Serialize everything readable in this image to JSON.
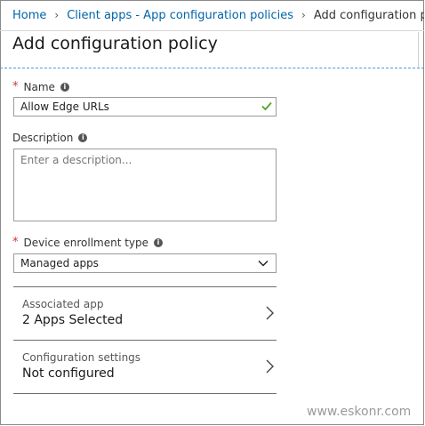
{
  "breadcrumb": {
    "items": [
      "Home",
      "Client apps - App configuration policies",
      "Add configuration policy"
    ]
  },
  "page": {
    "title": "Add configuration policy"
  },
  "form": {
    "name": {
      "label": "Name",
      "value": "Allow Edge URLs",
      "required": "*"
    },
    "description": {
      "label": "Description",
      "placeholder": "Enter a description..."
    },
    "device_enrollment": {
      "label": "Device enrollment type",
      "selected": "Managed apps",
      "required": "*"
    },
    "associated_app": {
      "label": "Associated app",
      "value": "2 Apps Selected"
    },
    "configuration_settings": {
      "label": "Configuration settings",
      "value": "Not configured"
    }
  },
  "watermark": "www.eskonr.com",
  "colors": {
    "link": "#0064a8",
    "accent_dashed": "#41a1d7",
    "check_green": "#5aa02c",
    "required_star": "#c33333"
  },
  "icons": [
    "chevron-right-icon",
    "info-icon",
    "checkmark-icon",
    "chevron-down-icon"
  ]
}
